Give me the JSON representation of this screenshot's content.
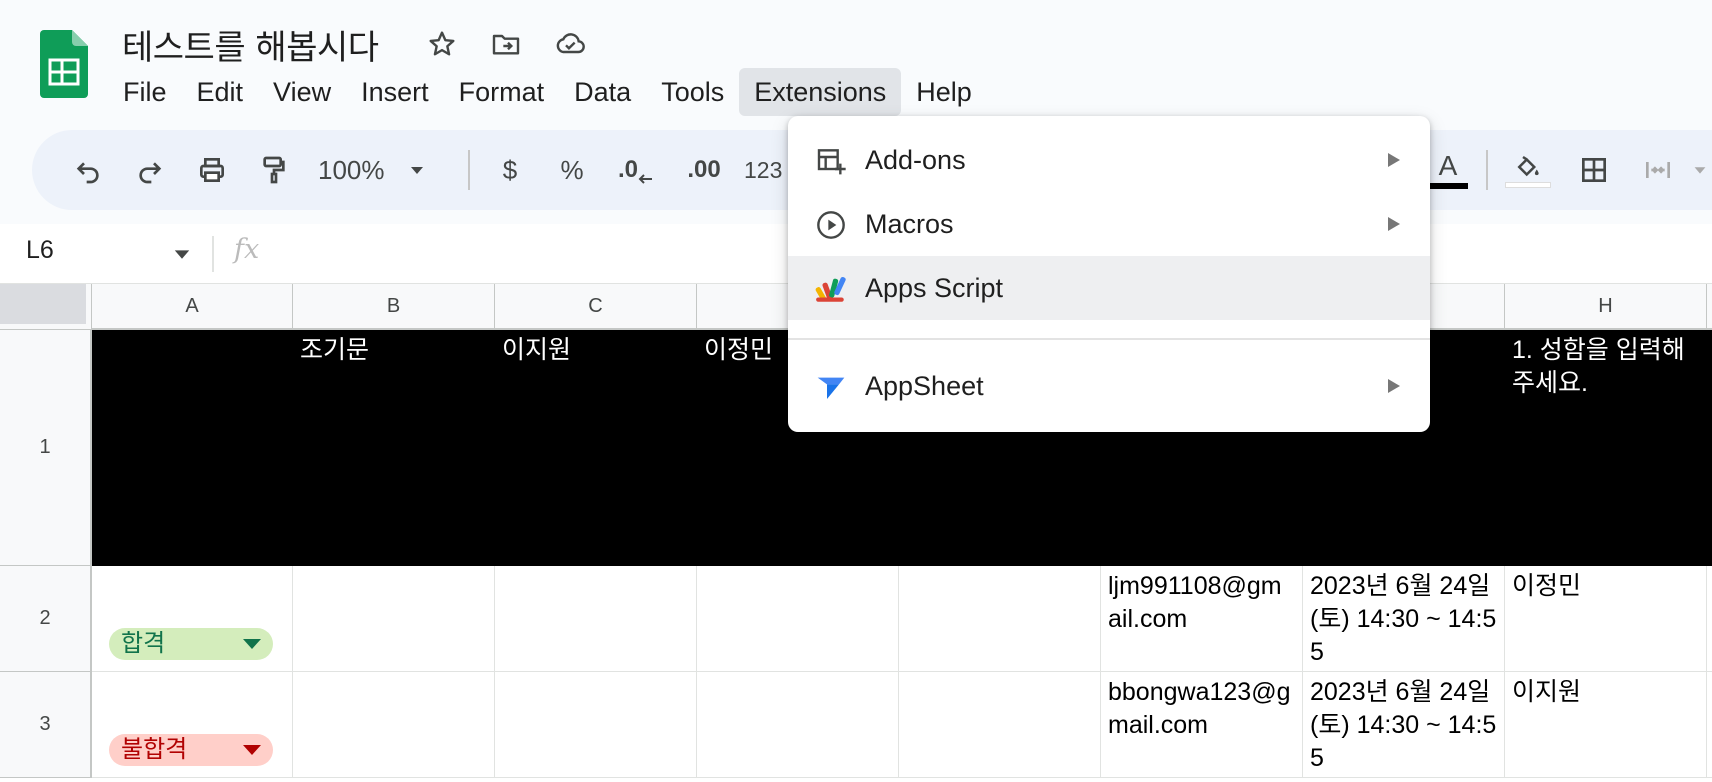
{
  "document": {
    "title": "테스트를 해봅시다"
  },
  "menu": {
    "items": [
      "File",
      "Edit",
      "View",
      "Insert",
      "Format",
      "Data",
      "Tools",
      "Extensions",
      "Help"
    ],
    "active": "Extensions"
  },
  "toolbar": {
    "zoom": "100%",
    "currency": "$",
    "percent": "%",
    "decrease_decimal": ".0",
    "increase_decimal": ".00",
    "number_format": "123",
    "text_color_label": "A"
  },
  "formula_bar": {
    "cell_ref": "L6",
    "fx": "fx",
    "value": ""
  },
  "extensions_menu": {
    "items": [
      {
        "label": "Add-ons",
        "icon": "add-ons-icon",
        "submenu": true
      },
      {
        "label": "Macros",
        "icon": "play-circle-icon",
        "submenu": true
      },
      {
        "label": "Apps Script",
        "icon": "apps-script-icon",
        "submenu": false,
        "highlighted": true
      },
      {
        "label": "AppSheet",
        "icon": "appsheet-icon",
        "submenu": true
      }
    ]
  },
  "sheet": {
    "columns": [
      "A",
      "B",
      "C",
      "H"
    ],
    "rows": [
      "1",
      "2",
      "3"
    ],
    "row1": {
      "b": "조기문",
      "c": "이지원",
      "d": "이정민",
      "h": "1. 성함을 입력해주세요."
    },
    "row2": {
      "status": "합격",
      "email": "ljm991108@gmail.com",
      "datetime": "2023년 6월 24일(토) 14:30 ~ 14:55",
      "name": "이정민"
    },
    "row3": {
      "status": "불합격",
      "email": "bbongwa123@gmail.com",
      "datetime": "2023년 6월 24일(토) 14:30 ~ 14:55",
      "name": "이지원"
    }
  },
  "colors": {
    "sheets_green": "#0f9d58",
    "header_bg": "#000000",
    "pass_chip_bg": "#d4edbc",
    "pass_chip_text": "#11734b",
    "fail_chip_bg": "#ffcfc9",
    "fail_chip_text": "#b10202"
  }
}
